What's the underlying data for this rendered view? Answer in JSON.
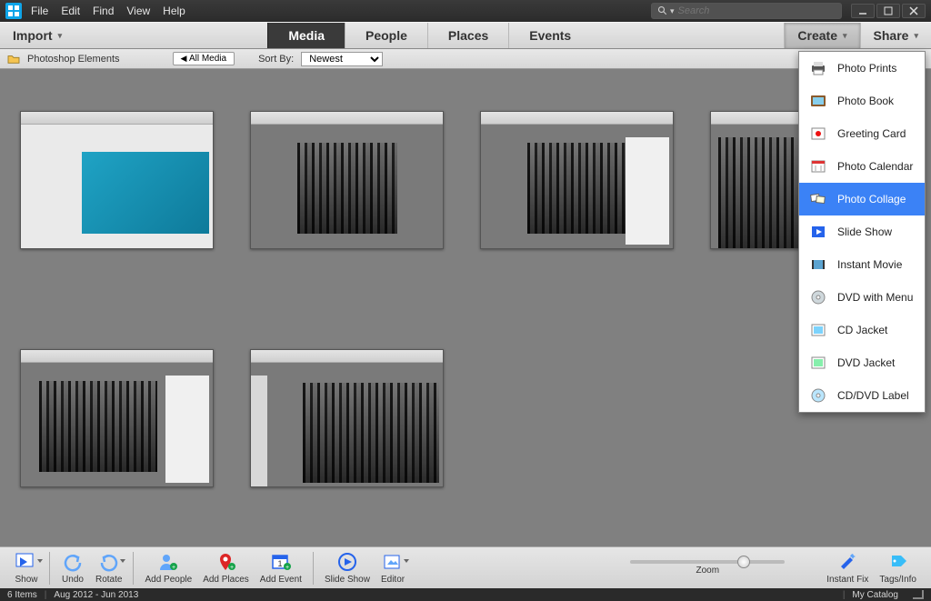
{
  "menu": {
    "file": "File",
    "edit": "Edit",
    "find": "Find",
    "view": "View",
    "help": "Help"
  },
  "search": {
    "placeholder": "Search"
  },
  "primary": {
    "import": "Import",
    "views": {
      "media": "Media",
      "people": "People",
      "places": "Places",
      "events": "Events"
    },
    "create": "Create",
    "share": "Share"
  },
  "filter": {
    "breadcrumb": "Photoshop Elements",
    "all_media": "All Media",
    "sort_by_label": "Sort By:",
    "sort_value": "Newest"
  },
  "create_menu": {
    "items": [
      {
        "id": "photo-prints",
        "label": "Photo Prints"
      },
      {
        "id": "photo-book",
        "label": "Photo Book"
      },
      {
        "id": "greeting-card",
        "label": "Greeting Card"
      },
      {
        "id": "photo-calendar",
        "label": "Photo Calendar"
      },
      {
        "id": "photo-collage",
        "label": "Photo Collage",
        "selected": true
      },
      {
        "id": "slide-show",
        "label": "Slide Show"
      },
      {
        "id": "instant-movie",
        "label": "Instant Movie"
      },
      {
        "id": "dvd-with-menu",
        "label": "DVD with Menu"
      },
      {
        "id": "cd-jacket",
        "label": "CD Jacket"
      },
      {
        "id": "dvd-jacket",
        "label": "DVD Jacket"
      },
      {
        "id": "cd-dvd-label",
        "label": "CD/DVD Label"
      }
    ]
  },
  "bottom": {
    "show": "Show",
    "undo": "Undo",
    "rotate": "Rotate",
    "add_people": "Add People",
    "add_places": "Add Places",
    "add_event": "Add Event",
    "slide_show": "Slide Show",
    "editor": "Editor",
    "zoom": "Zoom",
    "instant_fix": "Instant Fix",
    "tags_info": "Tags/Info"
  },
  "status": {
    "items": "6 Items",
    "date_range": "Aug 2012 - Jun 2013",
    "catalog": "My Catalog"
  }
}
